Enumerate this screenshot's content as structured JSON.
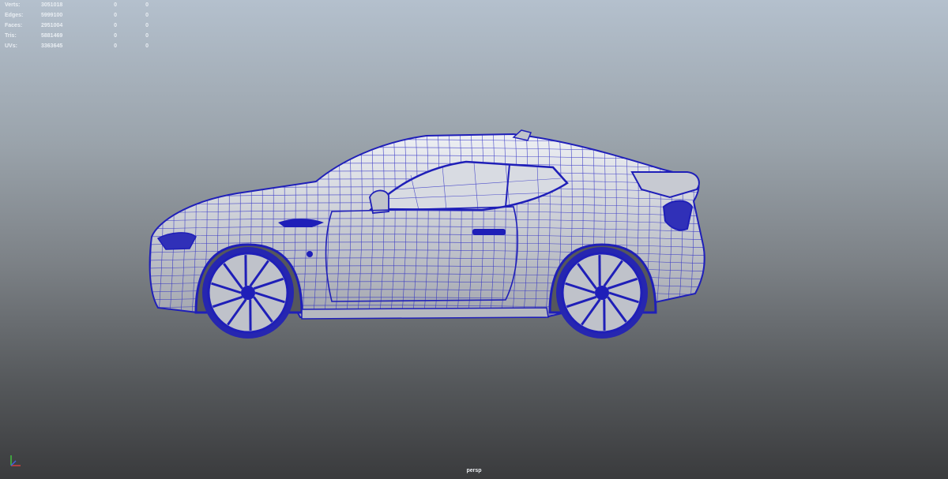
{
  "hud": {
    "rows": [
      {
        "label": "Verts:",
        "total": "3051018",
        "selected": "0",
        "component": "0"
      },
      {
        "label": "Edges:",
        "total": "5999100",
        "selected": "0",
        "component": "0"
      },
      {
        "label": "Faces:",
        "total": "2951004",
        "selected": "0",
        "component": "0"
      },
      {
        "label": "Tris:",
        "total": "5881469",
        "selected": "0",
        "component": "0"
      },
      {
        "label": "UVs:",
        "total": "3363645",
        "selected": "0",
        "component": "0"
      }
    ]
  },
  "viewport": {
    "camera_label": "persp",
    "wireframe_color": "#1f1fb8",
    "model": "sports-coupe-wireframe"
  },
  "axis_gizmo": {
    "x_color": "#d04040",
    "y_color": "#40c040",
    "z_color": "#4060e0"
  }
}
